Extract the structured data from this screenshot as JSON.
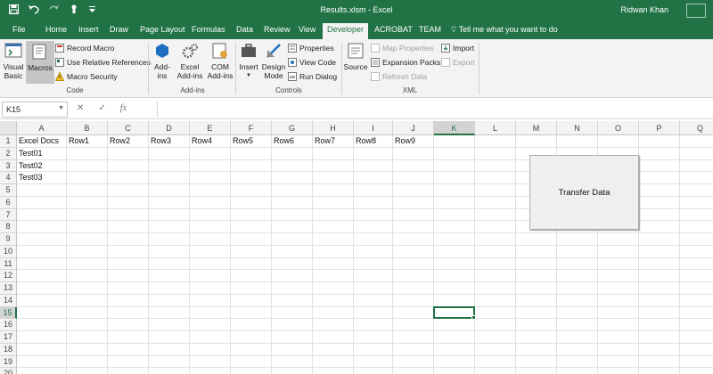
{
  "titlebar": {
    "title": "Results.xlsm - Excel",
    "user": "Ridwan Khan"
  },
  "tabs": [
    "File",
    "Home",
    "Insert",
    "Draw",
    "Page Layout",
    "Formulas",
    "Data",
    "Review",
    "View",
    "Developer",
    "ACROBAT",
    "TEAM"
  ],
  "active_tab": "Developer",
  "tell_me": "Tell me what you want to do",
  "ribbon": {
    "code": {
      "label": "Code",
      "visual_basic": "Visual Basic",
      "macros": "Macros",
      "record_macro": "Record Macro",
      "relative_refs": "Use Relative References",
      "macro_security": "Macro Security"
    },
    "addins": {
      "label": "Add-ins",
      "add_ins": "Add-ins",
      "excel_add_ins": "Excel Add-ins",
      "com_add_ins": "COM Add-ins"
    },
    "controls": {
      "label": "Controls",
      "insert": "Insert",
      "design_mode": "Design Mode",
      "properties": "Properties",
      "view_code": "View Code",
      "run_dialog": "Run Dialog"
    },
    "xml": {
      "label": "XML",
      "source": "Source",
      "map_properties": "Map Properties",
      "expansion_packs": "Expansion Packs",
      "refresh_data": "Refresh Data",
      "import": "Import",
      "export": "Export"
    }
  },
  "formula_bar": {
    "name_box": "K15",
    "cancel_icon": "✕",
    "enter_icon": "✓",
    "fx_label": "fx",
    "value": ""
  },
  "sheet": {
    "columns": [
      "A",
      "B",
      "C",
      "D",
      "E",
      "F",
      "G",
      "H",
      "I",
      "J",
      "K",
      "L",
      "M",
      "N",
      "O",
      "P",
      "Q"
    ],
    "rows": [
      "1",
      "2",
      "3",
      "4",
      "5",
      "6",
      "7",
      "8",
      "9",
      "10",
      "11",
      "12",
      "13",
      "14",
      "15",
      "16",
      "17",
      "18",
      "19",
      "20"
    ],
    "selected_column": "K",
    "selected_row": "15",
    "cells": {
      "A1": "Excel Docs",
      "B1": "Row1",
      "C1": "Row2",
      "D1": "Row3",
      "E1": "Row4",
      "F1": "Row5",
      "G1": "Row6",
      "H1": "Row7",
      "I1": "Row8",
      "J1": "Row9",
      "A2": "Test01",
      "A3": "Test02",
      "A4": "Test03"
    }
  },
  "transfer_button": "Transfer Data",
  "colors": {
    "accent": "#217346",
    "ribbon_bg": "#f3f3f3"
  }
}
